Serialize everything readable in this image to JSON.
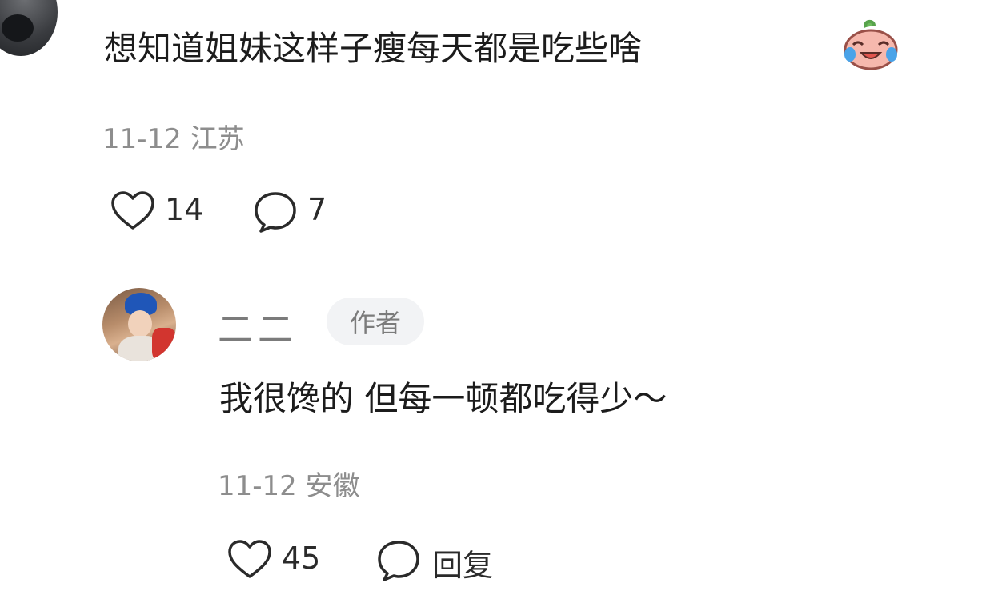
{
  "comment": {
    "text": "想知道姐妹这样子瘦每天都是吃些啥",
    "emoji": "crying-laughing-peach-emoji",
    "date": "11-12",
    "location": "江苏",
    "likes": "14",
    "replies": "7"
  },
  "reply": {
    "username": "二二",
    "badge": "作者",
    "text": "我很馋的 但每一顿都吃得少～",
    "date": "11-12",
    "location": "安徽",
    "likes": "45",
    "reply_label": "回复"
  },
  "icons": {
    "like": "heart-outline-icon",
    "comment": "speech-bubble-icon"
  },
  "colors": {
    "text": "#1c1c1c",
    "meta": "#8d8d8d",
    "badge_bg": "#f2f3f5"
  }
}
